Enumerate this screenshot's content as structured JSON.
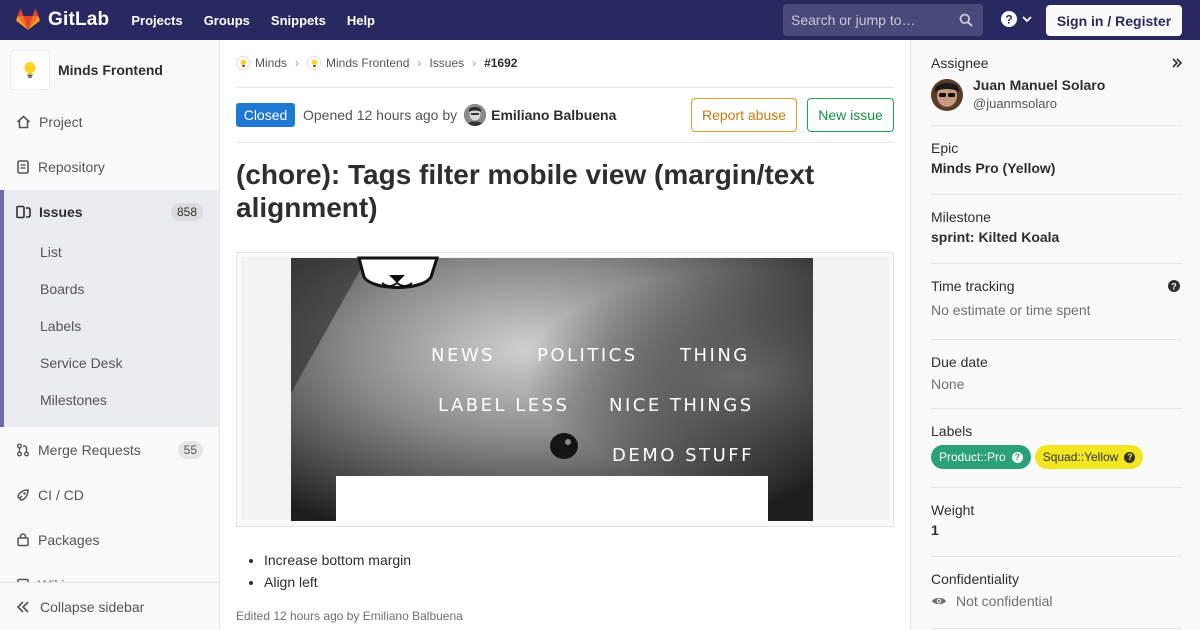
{
  "nav": {
    "logo_text": "GitLab",
    "links": [
      "Projects",
      "Groups",
      "Snippets",
      "Help"
    ],
    "search_placeholder": "Search or jump to…",
    "sign_in": "Sign in / Register",
    "bg_color": "#292961"
  },
  "sidebar": {
    "project_name": "Minds Frontend",
    "items": [
      {
        "label": "Project",
        "icon": "home-icon"
      },
      {
        "label": "Repository",
        "icon": "doc-icon"
      },
      {
        "label": "Issues",
        "icon": "issues-icon",
        "count": "858"
      },
      {
        "label": "Merge Requests",
        "icon": "merge-request-icon",
        "count": "55"
      },
      {
        "label": "CI / CD",
        "icon": "rocket-icon"
      },
      {
        "label": "Packages",
        "icon": "package-icon"
      },
      {
        "label": "Wiki",
        "icon": "book-icon"
      }
    ],
    "issues_sub": [
      "List",
      "Boards",
      "Labels",
      "Service Desk",
      "Milestones"
    ],
    "collapse_label": "Collapse sidebar"
  },
  "breadcrumb": [
    "Minds",
    "Minds Frontend",
    "Issues",
    "#1692"
  ],
  "issue": {
    "status": "Closed",
    "opened_text": "Opened 12 hours ago by",
    "author": "Emiliano Balbuena",
    "report_label": "Report abuse",
    "new_issue_label": "New issue",
    "title": "(chore): Tags filter mobile view (margin/text alignment)",
    "image_tags": [
      "NEWS",
      "POLITICS",
      "THING",
      "LABEL LESS",
      "NICE THINGS",
      "DEMO STUFF"
    ],
    "bullets": [
      "Increase bottom margin",
      "Align left"
    ],
    "edited": "Edited 12 hours ago by Emiliano Balbuena"
  },
  "right": {
    "assignee_label": "Assignee",
    "assignee_name": "Juan Manuel Solaro",
    "assignee_handle": "@juanmsolaro",
    "epic_label": "Epic",
    "epic_value": "Minds Pro (Yellow)",
    "milestone_label": "Milestone",
    "milestone_value": "sprint: Kilted Koala",
    "time_label": "Time tracking",
    "time_value": "No estimate or time spent",
    "due_label": "Due date",
    "due_value": "None",
    "labels_label": "Labels",
    "labels": [
      {
        "text": "Product::Pro",
        "bg": "#2aa177",
        "fg": "#ffffff"
      },
      {
        "text": "Squad::Yellow",
        "bg": "#f2e620",
        "fg": "#333333"
      }
    ],
    "weight_label": "Weight",
    "weight_value": "1",
    "confidentiality_label": "Confidentiality",
    "confidentiality_value": "Not confidential"
  }
}
